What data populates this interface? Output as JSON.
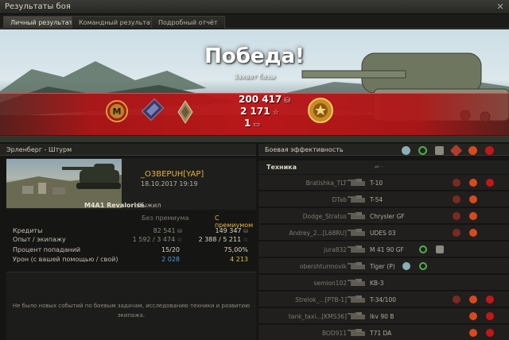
{
  "window": {
    "title": "Результаты боя",
    "close": "✕"
  },
  "tabs": [
    {
      "label": "Личный результат",
      "active": true
    },
    {
      "label": "Командный результат",
      "active": false
    },
    {
      "label": "Подробный отчёт",
      "active": false
    }
  ],
  "banner": {
    "result": "Победа!",
    "battle_type": "Захват базы",
    "credits": "200 417",
    "experience": "2 171",
    "free_xp_or_bonds": "1",
    "credits_icon": "credits-icon",
    "experience_icon": "star-icon",
    "free_icon": "bond-icon"
  },
  "map": {
    "label": "Эрленберг - Штурм"
  },
  "player": {
    "name": "_O3BEPUH[YAP]",
    "datetime": "18.10.2017 19:19",
    "tank": "M4A1 Revalorisé",
    "status": "Выжил"
  },
  "economy": {
    "col_without": "Без премиума",
    "col_with": "С премиумом",
    "rows": [
      {
        "label": "Кредиты",
        "without": "82 541",
        "with": "149 347",
        "icon": "credits-icon"
      },
      {
        "label": "Опыт / экипажу",
        "without": "1 592 / 3 474",
        "with": "2 388 / 5 211",
        "icon": "star-icon"
      },
      {
        "label": "Процент попаданий",
        "without": "15/20",
        "with": "75,00%",
        "icon": ""
      },
      {
        "label": "Урон (с вашей помощью / свой)",
        "without": "2 028",
        "with": "4 213",
        "icon": ""
      }
    ]
  },
  "notice": {
    "line1": "Не было новых событий по боевым задачам, исследованию техники и развитию",
    "line2": "экипажа."
  },
  "efficiency": {
    "title": "Боевая эффективность",
    "tech_header": "Техника",
    "players": [
      {
        "name": "Bratishka_TLT",
        "tank": "T-10"
      },
      {
        "name": "DTab",
        "tank": "T-54"
      },
      {
        "name": "Dodge_Stratus",
        "tank": "Chrysler GF"
      },
      {
        "name": "Andrey_2...[L68RU]",
        "tank": "UDES 03"
      },
      {
        "name": "jura832",
        "tank": "M 41 90 GF"
      },
      {
        "name": "obershturmovik",
        "tank": "Tiger (P)"
      },
      {
        "name": "semion102",
        "tank": "KB-3"
      },
      {
        "name": "Strelok_...[PTB-1]",
        "tank": "T-34/100"
      },
      {
        "name": "tank_taxi...[KMS36]",
        "tank": "Ikv 90 B"
      },
      {
        "name": "BOD911",
        "tank": "T71 DA"
      }
    ]
  },
  "colors": {
    "accent_gold": "#e6b33a",
    "victory_red": "#b01416",
    "damage_yellow": "#d8c23a",
    "assist_blue": "#4e9ad8"
  }
}
